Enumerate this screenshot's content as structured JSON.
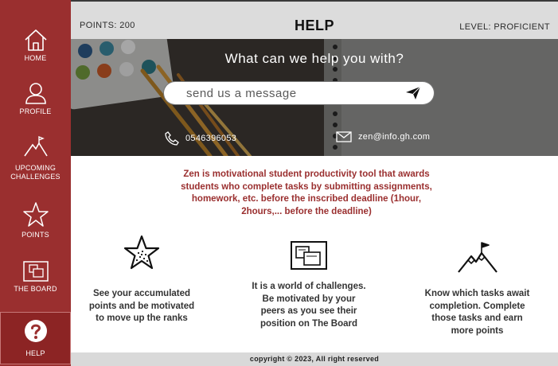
{
  "sidebar": {
    "items": [
      {
        "label": "HOME",
        "icon": "home-icon"
      },
      {
        "label": "PROFILE",
        "icon": "user-icon"
      },
      {
        "label_line1": "UPCOMING",
        "label_line2": "CHALLENGES",
        "icon": "mountain-flag-icon"
      },
      {
        "label": "POINTS",
        "icon": "star-icon"
      },
      {
        "label": "THE BOARD",
        "icon": "board-icon"
      },
      {
        "label": "HELP",
        "icon": "help-icon"
      }
    ]
  },
  "header": {
    "points": "POINTS: 200",
    "title": "HELP",
    "level": "LEVEL: PROFICIENT"
  },
  "hero": {
    "question": "What can we help you with?",
    "message_placeholder": "send us a message",
    "phone": "0546396053",
    "email": "zen@info.gh.com"
  },
  "description": {
    "line1": "Zen is motivational student productivity tool that awards",
    "line2": "students who complete tasks by submitting assignments,",
    "line3": "homework, etc. before the inscribed deadline (1hour,",
    "line4": "2hours,... before the deadline)"
  },
  "features": [
    {
      "icon": "star-icon",
      "line1": "See your accumulated",
      "line2": "points and be motivated",
      "line3": "to move up the ranks"
    },
    {
      "icon": "board-icon",
      "line1": "It is a world of challenges.",
      "line2": "Be motivated by your",
      "line3": "peers as you see their",
      "line4": "position on The Board"
    },
    {
      "icon": "mountain-flag-icon",
      "line1": "Know which tasks await",
      "line2": "completion. Complete",
      "line3": "those tasks and earn",
      "line4": "more points"
    }
  ],
  "footer": {
    "copyright": "copyright © 2023, All right reserved"
  },
  "colors": {
    "brand": "#9a2f2f",
    "topbar": "#dcdcdc",
    "footer": "#d9d9d9"
  }
}
